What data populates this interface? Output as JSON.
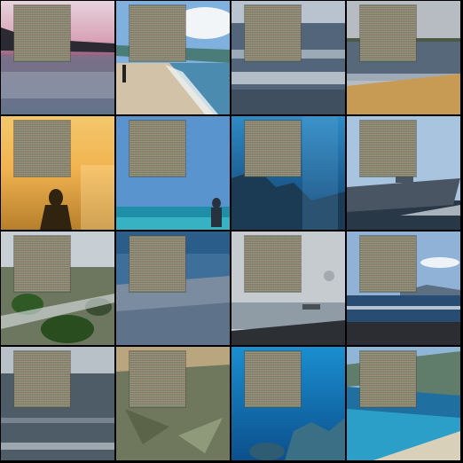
{
  "grid": {
    "rows": 4,
    "columns": 4,
    "tiles": [
      {
        "scene": "pink-sunset-lake",
        "colors": [
          "#d9a1b6",
          "#8b5a78",
          "#5c6f85"
        ]
      },
      {
        "scene": "pebble-beach-waves",
        "colors": [
          "#7fb0de",
          "#4c8bb0",
          "#d2c2a8"
        ]
      },
      {
        "scene": "grey-sea-surf",
        "colors": [
          "#9aa7b8",
          "#52657a",
          "#ced6df"
        ]
      },
      {
        "scene": "sandy-beach-dusk",
        "colors": [
          "#b7bcc2",
          "#56687a",
          "#c89b55"
        ]
      },
      {
        "scene": "golden-sunset-silhouette",
        "colors": [
          "#f2b451",
          "#c88a30",
          "#30230f"
        ]
      },
      {
        "scene": "blue-sea-person",
        "colors": [
          "#5a94cf",
          "#1f8ea9",
          "#27323f"
        ]
      },
      {
        "scene": "underwater-reef-dark",
        "colors": [
          "#1e6ea8",
          "#0e3c6a",
          "#2b5e86"
        ]
      },
      {
        "scene": "navy-warship",
        "colors": [
          "#a9c4de",
          "#4a5563",
          "#283846"
        ]
      },
      {
        "scene": "mossy-rocks-stream",
        "colors": [
          "#6d7760",
          "#2f5a26",
          "#c7cfd4"
        ]
      },
      {
        "scene": "underwater-seabed",
        "colors": [
          "#3d6f9a",
          "#7b8ba0",
          "#4b6a80"
        ]
      },
      {
        "scene": "hazy-harbor",
        "colors": [
          "#c6cbcf",
          "#8f9ba5",
          "#2c2f33"
        ]
      },
      {
        "scene": "coast-blue-sky",
        "colors": [
          "#8fb2d6",
          "#294d72",
          "#2c2d33"
        ]
      },
      {
        "scene": "calm-grey-sea",
        "colors": [
          "#b8c0c8",
          "#4e5c68",
          "#2a3440"
        ]
      },
      {
        "scene": "shallow-seaweed",
        "colors": [
          "#8e9a7a",
          "#6f785d",
          "#b9a67f"
        ]
      },
      {
        "scene": "underwater-coral-blue",
        "colors": [
          "#1a8fd0",
          "#0c4f8c",
          "#3a6f85"
        ]
      },
      {
        "scene": "turquoise-bay",
        "colors": [
          "#2c9fc8",
          "#1f6fa0",
          "#d8d0b8"
        ]
      }
    ]
  }
}
